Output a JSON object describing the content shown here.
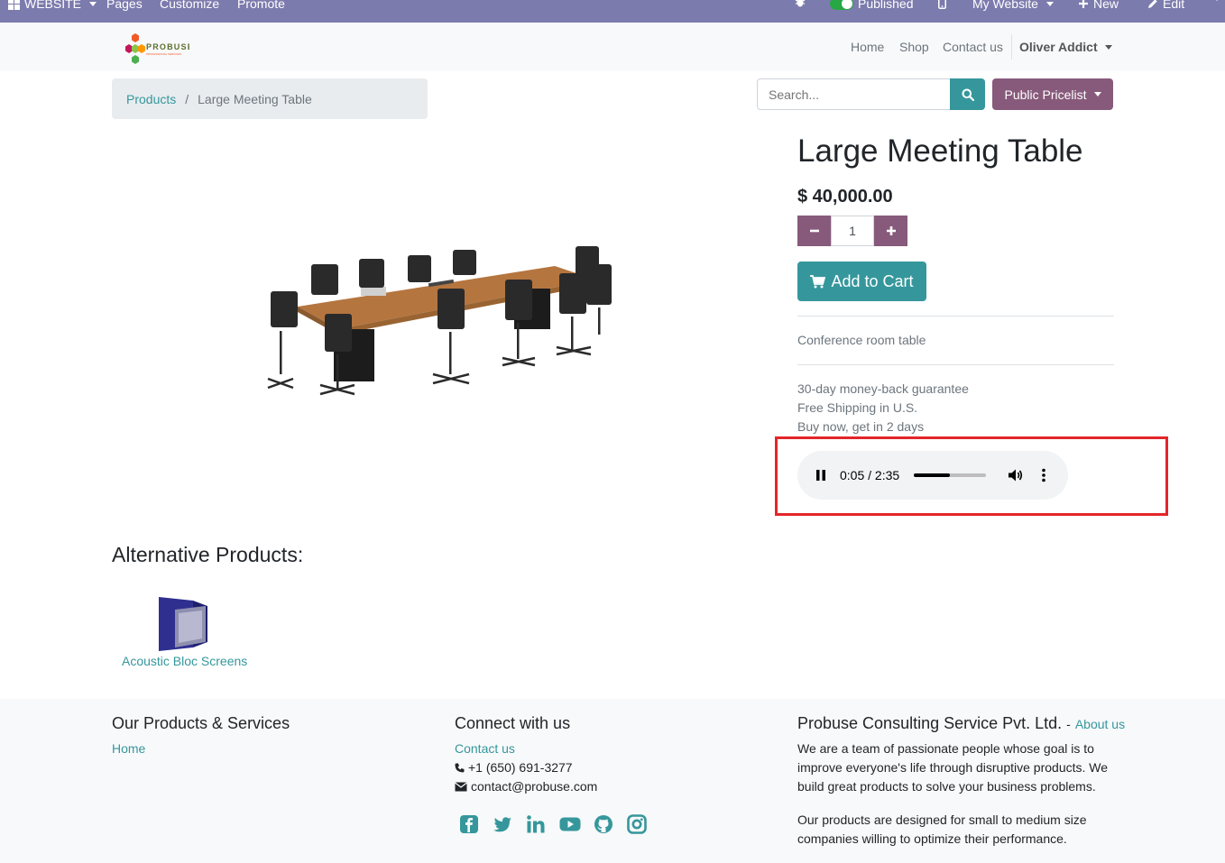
{
  "adminbar": {
    "website_label": "WEBSITE",
    "pages_label": "Pages",
    "customize_label": "Customize",
    "promote_label": "Promote",
    "published_label": "Published",
    "my_website_label": "My Website",
    "new_label": "New",
    "edit_label": "Edit"
  },
  "header": {
    "logo_text": "PROBUSE",
    "logo_subtext": "PROFESSIONAL SERVICES",
    "nav": [
      "Home",
      "Shop",
      "Contact us"
    ],
    "user": "Oliver Addict"
  },
  "breadcrumb": {
    "parent": "Products",
    "separator": "/",
    "current": "Large Meeting Table"
  },
  "search": {
    "placeholder": "Search..."
  },
  "pricelist_label": "Public Pricelist",
  "product": {
    "title": "Large Meeting Table",
    "price": "$ 40,000.00",
    "quantity": "1",
    "add_to_cart": "Add to Cart",
    "description": "Conference room table",
    "guarantees": [
      "30-day money-back guarantee",
      "Free Shipping in U.S.",
      "Buy now, get in 2 days"
    ]
  },
  "audio": {
    "time": "0:05 / 2:35",
    "volume_level": 0.5
  },
  "alternatives": {
    "title": "Alternative Products:",
    "items": [
      {
        "name": "Acoustic Bloc Screens"
      }
    ]
  },
  "footer": {
    "col1": {
      "title": "Our Products & Services",
      "links": [
        "Home"
      ]
    },
    "col2": {
      "title": "Connect with us",
      "contact_link": "Contact us",
      "phone": "+1 (650) 691-3277",
      "email": "contact@probuse.com"
    },
    "col3": {
      "title": "Probuse Consulting Service Pvt. Ltd.",
      "title_sep": "-",
      "about_link": "About us",
      "para1": [
        "We are a team of passionate people whose goal is to",
        "improve everyone's life through disruptive products. We",
        "build great products to solve your business problems."
      ],
      "para2": [
        "Our products are designed for small to medium size",
        "companies willing to optimize their performance."
      ]
    }
  },
  "colors": {
    "admin_bar": "#7c7bad",
    "teal": "#35979c",
    "purple": "#875a7b",
    "highlight": "#e3262a"
  },
  "icons": [
    "grid-icon",
    "bug-icon",
    "mobile-icon",
    "plus-icon",
    "pencil-icon",
    "search-icon",
    "cart-icon",
    "pause-icon",
    "volume-icon",
    "more-vertical-icon",
    "phone-icon",
    "envelope-icon",
    "facebook-icon",
    "twitter-icon",
    "linkedin-icon",
    "youtube-icon",
    "github-icon",
    "instagram-icon"
  ]
}
